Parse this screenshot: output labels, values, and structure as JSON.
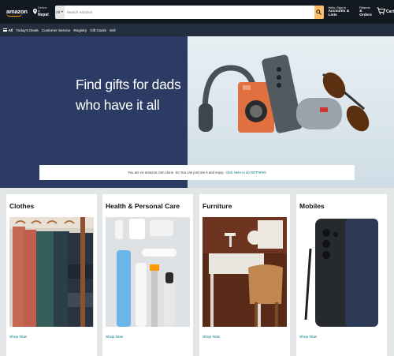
{
  "header": {
    "logo_text": "amazon",
    "deliver_line1": "Deliver to",
    "deliver_line2": "Nepal",
    "search_category": "All",
    "search_placeholder": "Search Amazon",
    "account_line1": "Hello, Sign in",
    "account_line2": "Accounts & Lists",
    "orders_line1": "Returns",
    "orders_line2": "& Orders",
    "cart_label": "Cart"
  },
  "subnav": {
    "items": [
      "All",
      "Today's Deals",
      "Customer Service",
      "Registry",
      "Gift Cards",
      "Sell"
    ]
  },
  "hero": {
    "title": "Find gifts for dads who have it all",
    "notice_text": "You are on amazon.com clone. So You can just see it and enjoy.",
    "notice_link": "Click Here to do NOTHING"
  },
  "cards": [
    {
      "title": "Clothes",
      "link": "Shop Now"
    },
    {
      "title": "Health & Personal Care",
      "link": "Shop Now"
    },
    {
      "title": "Furniture",
      "link": "Shop Now"
    },
    {
      "title": "Mobiles",
      "link": "Shop Now"
    }
  ],
  "colors": {
    "nav_top": "#131921",
    "nav_sub": "#232f3e",
    "search_button": "#febd69",
    "link": "#007185",
    "hero_left": "#2b3b63"
  },
  "icons": [
    "location-pin-icon",
    "search-icon",
    "cart-icon",
    "hamburger-icon",
    "dropdown-caret-icon"
  ]
}
